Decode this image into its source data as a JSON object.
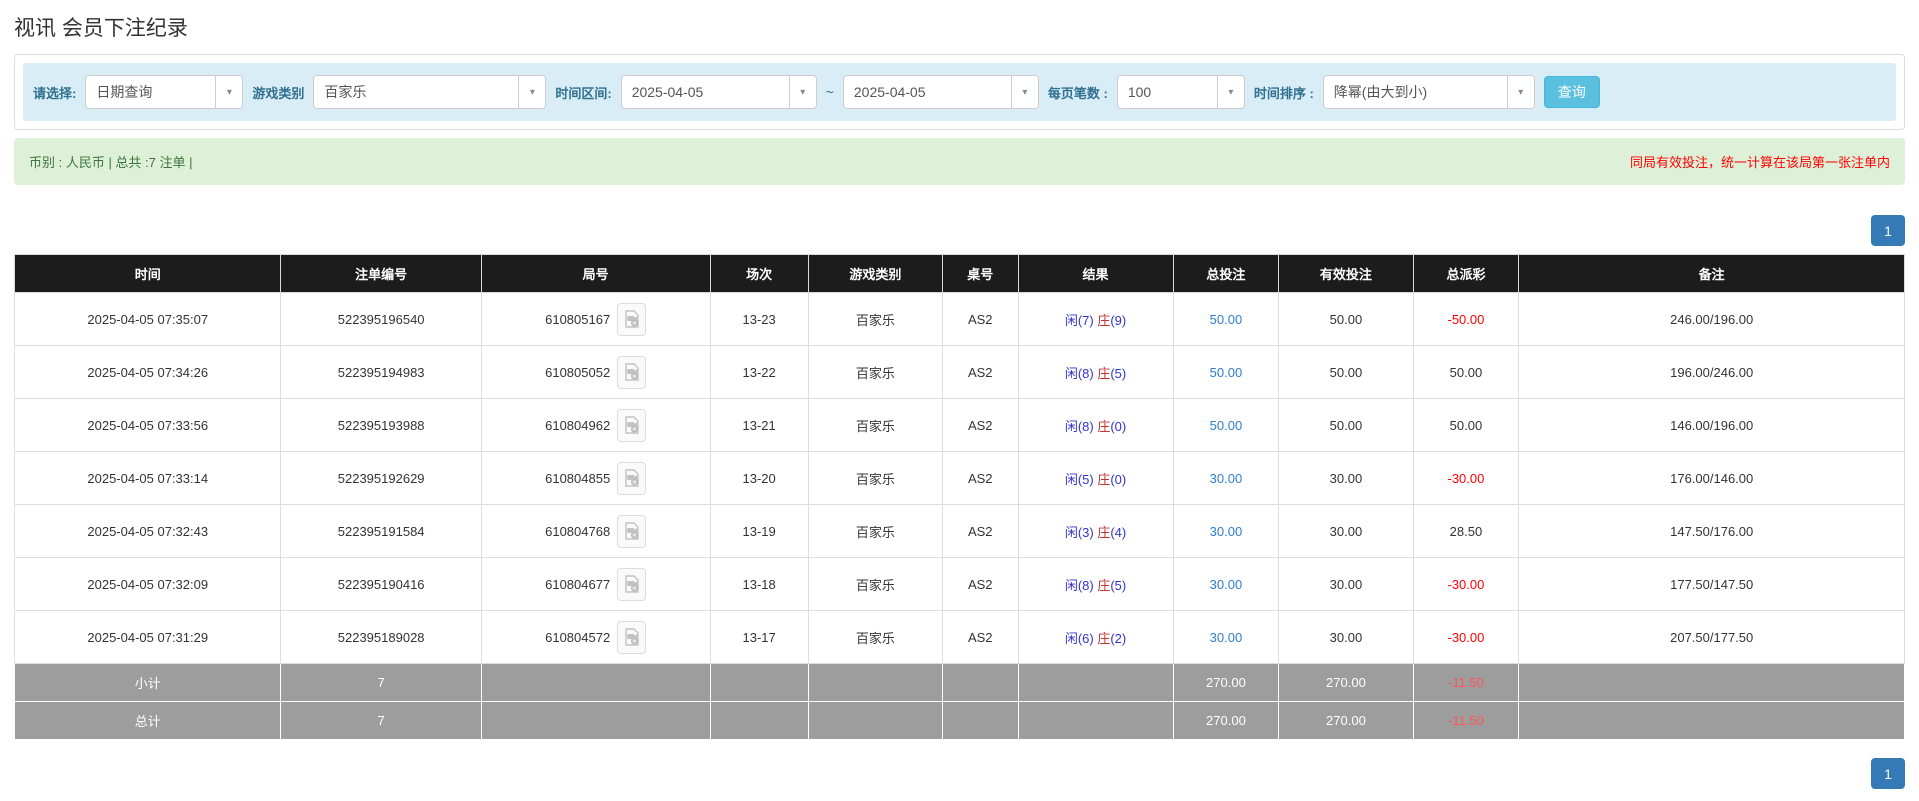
{
  "page": {
    "title": "视讯 会员下注纪录"
  },
  "filters": {
    "select_label": "请选择:",
    "select_value": "日期查询",
    "game_type_label": "游戏类别",
    "game_type_value": "百家乐",
    "time_range_label": "时间区间:",
    "date_from": "2025-04-05",
    "tilde": "~",
    "date_to": "2025-04-05",
    "page_size_label": "每页笔数 :",
    "page_size_value": "100",
    "sort_label": "时间排序 :",
    "sort_value": "降幂(由大到小)",
    "search_button": "查询"
  },
  "summary": {
    "left": "币别 : 人民币 | 总共 :7 注单 |",
    "right_note": "同局有效投注，统一计算在该局第一张注单内"
  },
  "pagination": {
    "page": "1"
  },
  "colors": {
    "accent_blue": "#337ab7",
    "info_bar": "#d9edf7",
    "success_bar": "#dff0d8",
    "header_dark": "#1c1c1c",
    "total_gray": "#9d9d9d",
    "negative_red": "#ff0000",
    "player_blue": "#3333cc",
    "banker_red": "#c53232"
  },
  "table": {
    "headers": [
      "时间",
      "注单编号",
      "局号",
      "场次",
      "游戏类别",
      "桌号",
      "结果",
      "总投注",
      "有效投注",
      "总派彩",
      "备注"
    ],
    "col_widths": [
      "14.1%",
      "10.6%",
      "12.1%",
      "5.2%",
      "7.1%",
      "4.0%",
      "8.2%",
      "5.6%",
      "7.1%",
      "5.6%",
      "20.4%"
    ],
    "video_icon": "video-icon",
    "rows": [
      {
        "time": "2025-04-05 07:35:07",
        "bet_id": "522395196540",
        "round_id": "610805167",
        "session": "13-23",
        "game": "百家乐",
        "table_no": "AS2",
        "result_player": "闲(7)",
        "result_banker": "庄",
        "result_banker_num": "(9)",
        "total_bet": "50.00",
        "valid_bet": "50.00",
        "payout": "-50.00",
        "remark": "246.00/196.00"
      },
      {
        "time": "2025-04-05 07:34:26",
        "bet_id": "522395194983",
        "round_id": "610805052",
        "session": "13-22",
        "game": "百家乐",
        "table_no": "AS2",
        "result_player": "闲(8)",
        "result_banker": "庄",
        "result_banker_num": "(5)",
        "total_bet": "50.00",
        "valid_bet": "50.00",
        "payout": "50.00",
        "remark": "196.00/246.00"
      },
      {
        "time": "2025-04-05 07:33:56",
        "bet_id": "522395193988",
        "round_id": "610804962",
        "session": "13-21",
        "game": "百家乐",
        "table_no": "AS2",
        "result_player": "闲(8)",
        "result_banker": "庄",
        "result_banker_num": "(0)",
        "total_bet": "50.00",
        "valid_bet": "50.00",
        "payout": "50.00",
        "remark": "146.00/196.00"
      },
      {
        "time": "2025-04-05 07:33:14",
        "bet_id": "522395192629",
        "round_id": "610804855",
        "session": "13-20",
        "game": "百家乐",
        "table_no": "AS2",
        "result_player": "闲(5)",
        "result_banker": "庄",
        "result_banker_num": "(0)",
        "total_bet": "30.00",
        "valid_bet": "30.00",
        "payout": "-30.00",
        "remark": "176.00/146.00"
      },
      {
        "time": "2025-04-05 07:32:43",
        "bet_id": "522395191584",
        "round_id": "610804768",
        "session": "13-19",
        "game": "百家乐",
        "table_no": "AS2",
        "result_player": "闲(3)",
        "result_banker": "庄",
        "result_banker_num": "(4)",
        "total_bet": "30.00",
        "valid_bet": "30.00",
        "payout": "28.50",
        "remark": "147.50/176.00"
      },
      {
        "time": "2025-04-05 07:32:09",
        "bet_id": "522395190416",
        "round_id": "610804677",
        "session": "13-18",
        "game": "百家乐",
        "table_no": "AS2",
        "result_player": "闲(8)",
        "result_banker": "庄",
        "result_banker_num": "(5)",
        "total_bet": "30.00",
        "valid_bet": "30.00",
        "payout": "-30.00",
        "remark": "177.50/147.50"
      },
      {
        "time": "2025-04-05 07:31:29",
        "bet_id": "522395189028",
        "round_id": "610804572",
        "session": "13-17",
        "game": "百家乐",
        "table_no": "AS2",
        "result_player": "闲(6)",
        "result_banker": "庄",
        "result_banker_num": "(2)",
        "total_bet": "30.00",
        "valid_bet": "30.00",
        "payout": "-30.00",
        "remark": "207.50/177.50"
      }
    ],
    "subtotal": {
      "label": "小计",
      "count": "7",
      "total_bet": "270.00",
      "valid_bet": "270.00",
      "payout": "-11.50"
    },
    "total": {
      "label": "总计",
      "count": "7",
      "total_bet": "270.00",
      "valid_bet": "270.00",
      "payout": "-11.50"
    }
  }
}
